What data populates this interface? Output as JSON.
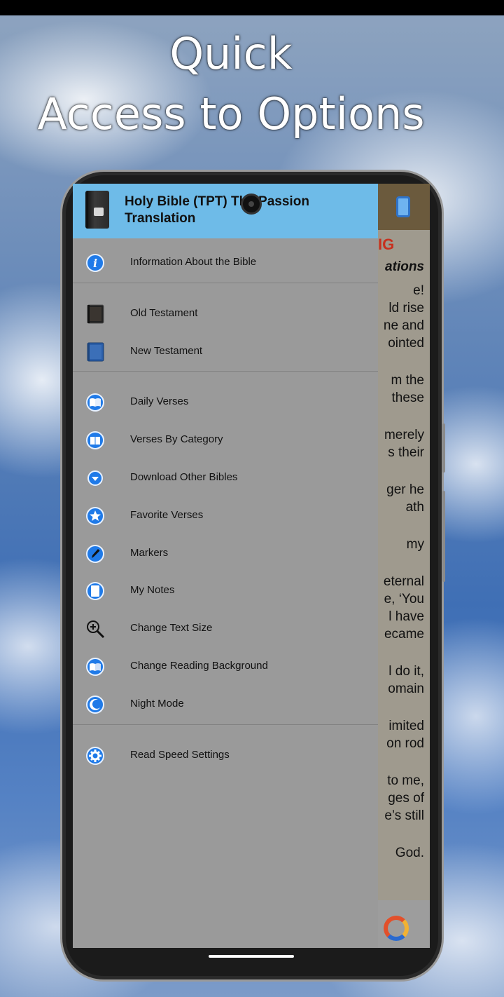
{
  "promo": {
    "line1": "Quick",
    "line2": "Access to Options"
  },
  "drawer": {
    "title": "Holy Bible (TPT) The Passion Translation",
    "groups": [
      [
        {
          "label": "Information About the Bible",
          "icon": "info-icon"
        }
      ],
      [
        {
          "label": "Old Testament",
          "icon": "old-testament-book-icon"
        },
        {
          "label": "New Testament",
          "icon": "new-testament-book-icon"
        }
      ],
      [
        {
          "label": "Daily Verses",
          "icon": "open-book-icon"
        },
        {
          "label": "Verses By Category",
          "icon": "book-category-icon"
        },
        {
          "label": "Download Other Bibles",
          "icon": "download-icon"
        },
        {
          "label": "Favorite Verses",
          "icon": "star-icon"
        },
        {
          "label": "Markers",
          "icon": "pen-icon"
        },
        {
          "label": "My Notes",
          "icon": "notes-icon"
        },
        {
          "label": "Change Text Size",
          "icon": "zoom-in-icon"
        },
        {
          "label": "Change Reading Background",
          "icon": "reading-background-icon"
        },
        {
          "label": "Night Mode",
          "icon": "moon-icon"
        }
      ],
      [
        {
          "label": "Read Speed Settings",
          "icon": "speed-settings-icon"
        }
      ]
    ]
  },
  "reader": {
    "heading_fragment": "IG",
    "subheading_fragment": "ations",
    "lines": [
      "e!",
      "ld rise",
      "ne and",
      "ointed",
      "m the",
      "these",
      "merely",
      "s their",
      "ger he",
      "ath",
      "my",
      "eternal",
      "e, ‘You",
      "l have",
      "ecame",
      "l do it,",
      "omain",
      "imited",
      "on rod",
      "to me,",
      "ges of",
      "e’s still",
      "God."
    ]
  },
  "colors": {
    "header_bg": "#6ebbe8",
    "drawer_bg": "#9a9a9a",
    "icon_blue": "#1f7ae8"
  }
}
